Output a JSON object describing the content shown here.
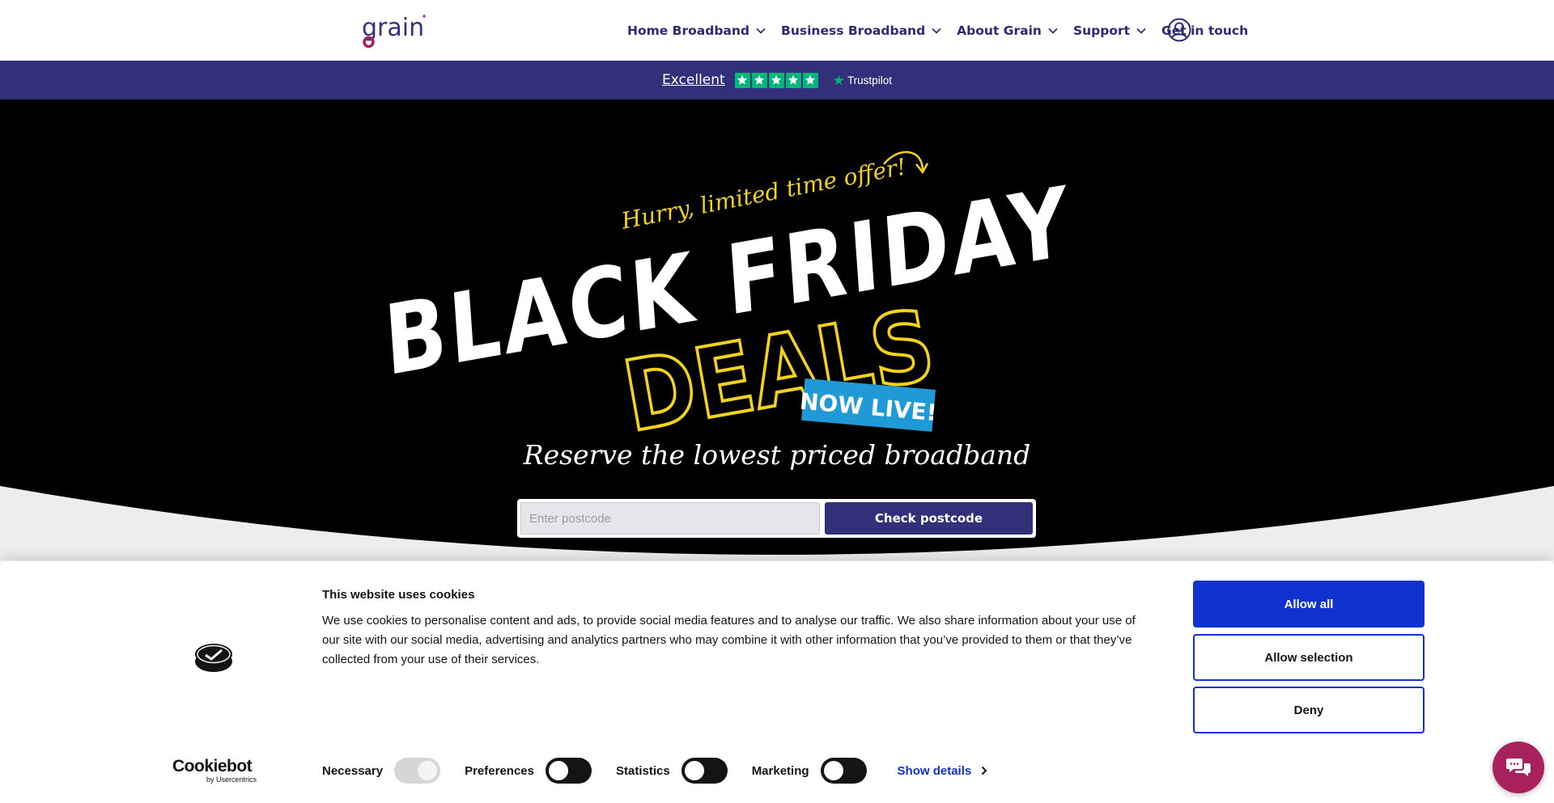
{
  "brand": {
    "logo_text": "grain"
  },
  "nav": {
    "items": [
      {
        "label": "Home Broadband",
        "has_dropdown": true
      },
      {
        "label": "Business Broadband",
        "has_dropdown": true
      },
      {
        "label": "About Grain",
        "has_dropdown": true
      },
      {
        "label": "Support",
        "has_dropdown": true
      },
      {
        "label": "Get in touch",
        "has_dropdown": false
      }
    ],
    "account_icon": "user-circle-icon"
  },
  "trustbar": {
    "rating_label": "Excellent",
    "stars": 5,
    "provider": "Trustpilot"
  },
  "hero": {
    "kicker": "Hurry, limited time offer!",
    "headline_line1": "BLACK FRIDAY",
    "headline_line2": "DEALS",
    "badge": "NOW LIVE!",
    "tagline": "Reserve the lowest priced broadband",
    "postcode_placeholder": "Enter postcode",
    "postcode_value": "",
    "check_button": "Check postcode"
  },
  "cookie_banner": {
    "title": "This website uses cookies",
    "body": "We use cookies to personalise content and ads, to provide social media features and to analyse our traffic. We also share information about your use of our site with our social media, advertising and analytics partners who may combine it with other information that you’ve provided to them or that they’ve collected from your use of their services.",
    "buttons": {
      "allow_all": "Allow all",
      "allow_selection": "Allow selection",
      "deny": "Deny"
    },
    "consents": [
      {
        "label": "Necessary",
        "state": "on-disabled"
      },
      {
        "label": "Preferences",
        "state": "off"
      },
      {
        "label": "Statistics",
        "state": "off"
      },
      {
        "label": "Marketing",
        "state": "off"
      }
    ],
    "show_details": "Show details",
    "powered_by": {
      "name": "Cookiebot",
      "sub": "by Usercentrics"
    }
  },
  "colors": {
    "brand_purple": "#33307a",
    "accent_yellow": "#f2d21b",
    "badge_blue": "#1f9ad6",
    "cookie_blue": "#1032cf",
    "chat_magenta": "#a8205c",
    "trustpilot_green": "#00b67a"
  },
  "chat": {
    "icon": "chat-bubbles-icon"
  }
}
